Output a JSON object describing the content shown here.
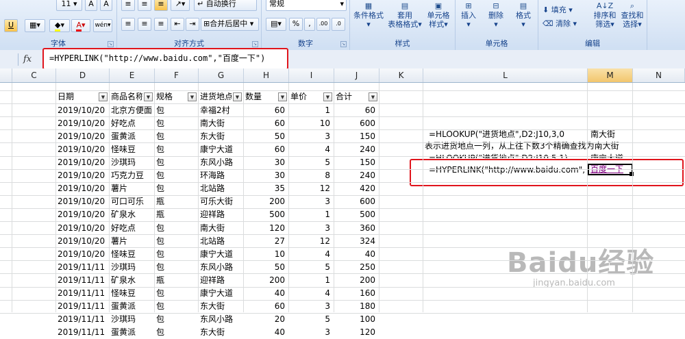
{
  "ribbon": {
    "font": {
      "size": "11",
      "group_label": "字体"
    },
    "alignment": {
      "wrap_label": "自动换行",
      "merge_label": "合并后居中",
      "group_label": "对齐方式"
    },
    "number": {
      "format": "常规",
      "group_label": "数字"
    },
    "styles": {
      "cond_format": "条件格式",
      "table_format_1": "套用",
      "table_format_2": "表格格式",
      "cell_style_1": "单元格",
      "cell_style_2": "样式",
      "group_label": "样式"
    },
    "cells": {
      "insert": "插入",
      "delete": "删除",
      "format": "格式",
      "group_label": "单元格"
    },
    "editing": {
      "fill": "填充",
      "clear": "清除",
      "sort_1": "排序和",
      "sort_2": "筛选",
      "find_1": "查找和",
      "find_2": "选择",
      "group_label": "编辑"
    }
  },
  "formula_bar": {
    "fx": "fx",
    "formula": "=HYPERLINK(\"http://www.baidu.com\",\"百度一下\")"
  },
  "columns": [
    "C",
    "D",
    "E",
    "F",
    "G",
    "H",
    "I",
    "J",
    "K",
    "L",
    "M",
    "N"
  ],
  "selected_column": "M",
  "table": {
    "headers": [
      "日期",
      "商品名称",
      "规格",
      "进货地点",
      "数量",
      "单价",
      "合计"
    ],
    "rows": [
      [
        "2019/10/20",
        "北京方便面",
        "包",
        "幸福2村",
        "60",
        "1",
        "60"
      ],
      [
        "2019/10/20",
        "好吃点",
        "包",
        "南大街",
        "60",
        "10",
        "600"
      ],
      [
        "2019/10/20",
        "蛋黄派",
        "包",
        "东大街",
        "50",
        "3",
        "150"
      ],
      [
        "2019/10/20",
        "怪味豆",
        "包",
        "康宁大道",
        "60",
        "4",
        "240"
      ],
      [
        "2019/10/20",
        "沙琪玛",
        "包",
        "东风小路",
        "30",
        "5",
        "150"
      ],
      [
        "2019/10/20",
        "巧克力豆",
        "包",
        "环海路",
        "30",
        "8",
        "240"
      ],
      [
        "2019/10/20",
        "薯片",
        "包",
        "北站路",
        "35",
        "12",
        "420"
      ],
      [
        "2019/10/20",
        "可口可乐",
        "瓶",
        "可乐大街",
        "200",
        "3",
        "600"
      ],
      [
        "2019/10/20",
        "矿泉水",
        "瓶",
        "迎祥路",
        "500",
        "1",
        "500"
      ],
      [
        "2019/10/20",
        "好吃点",
        "包",
        "南大街",
        "120",
        "3",
        "360"
      ],
      [
        "2019/10/20",
        "薯片",
        "包",
        "北站路",
        "27",
        "12",
        "324"
      ],
      [
        "2019/10/20",
        "怪味豆",
        "包",
        "康宁大道",
        "10",
        "4",
        "40"
      ],
      [
        "2019/11/11",
        "沙琪玛",
        "包",
        "东风小路",
        "50",
        "5",
        "250"
      ],
      [
        "2019/11/11",
        "矿泉水",
        "瓶",
        "迎祥路",
        "200",
        "1",
        "200"
      ],
      [
        "2019/11/11",
        "怪味豆",
        "包",
        "康宁大道",
        "40",
        "4",
        "160"
      ],
      [
        "2019/11/11",
        "蛋黄派",
        "包",
        "东大街",
        "60",
        "3",
        "180"
      ],
      [
        "2019/11/11",
        "沙琪玛",
        "包",
        "东风小路",
        "20",
        "5",
        "100"
      ],
      [
        "2019/11/11",
        "蛋黄派",
        "包",
        "东大街",
        "40",
        "3",
        "120"
      ]
    ]
  },
  "notes": {
    "l1": "=HLOOKUP(\"进货地点\",D2:J10,3,0",
    "m1": "南大街",
    "l2": "表示进货地点一列，从上往下数3个精确查找为南大街",
    "l3": "=HLOOKUP(\"进货地点\",D2:J10,5,1)",
    "m3": "康宁大道",
    "l4": "=HYPERLINK(\"http://www.baidu.com\",",
    "m4": "百度一下"
  },
  "watermark": {
    "brand": "Baidu经验",
    "url": "jingyan.baidu.com"
  },
  "colors": {
    "ribbon": "#dbe7f6",
    "highlight": "#e0141c",
    "link": "#800080"
  }
}
